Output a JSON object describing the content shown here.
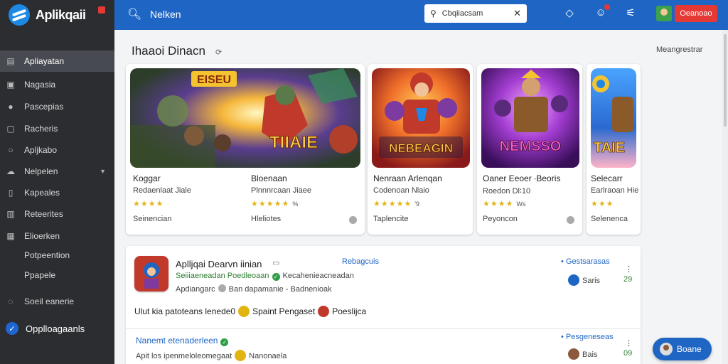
{
  "app": {
    "name": "Aplikqaii",
    "topbar_title": "Nelken"
  },
  "search": {
    "value": "Cbqiiacsam"
  },
  "topbar": {
    "button_label": "Oeanoao"
  },
  "sidebar": {
    "items": [
      {
        "label": "Apliayatan",
        "icon": "file-icon",
        "active": true
      },
      {
        "label": "Nagasia",
        "icon": "image-icon"
      },
      {
        "label": "Pascepias",
        "icon": "user-icon"
      },
      {
        "label": "Racheris",
        "icon": "box-icon"
      },
      {
        "label": "Apljkabo",
        "icon": "circle-icon"
      },
      {
        "label": "Nelpelen",
        "icon": "cloud-icon"
      },
      {
        "label": "Kapeales",
        "icon": "doc-icon"
      },
      {
        "label": "Reteerites",
        "icon": "device-icon"
      },
      {
        "label": "Elioerken",
        "icon": "grid-icon"
      },
      {
        "label": "Potpeention"
      },
      {
        "label": "Ppapele"
      },
      {
        "label": "Soeil eanerie",
        "icon": "help-icon"
      },
      {
        "label": "Opplloagaanls",
        "icon": "check-badge-icon"
      }
    ]
  },
  "section": {
    "title": "Ihaaoi Dinacn",
    "see_more": "Meangrestrar"
  },
  "cards": [
    {
      "title": "Koggar",
      "subtitle": "Redaenlaat Jiale",
      "stars": "★★★★",
      "count": "",
      "footer": "Seinencian",
      "image_text": "EISEU",
      "image_text2": "TIIAIE"
    },
    {
      "title": "Bloenaan",
      "subtitle": "Plnnnrcaan Jiaee",
      "stars": "★★★★★",
      "count": "%",
      "footer": "Hleliotes"
    },
    {
      "title": "Nenraan Arlenqan",
      "subtitle": "Codenoan Nlaio",
      "stars": "★★★★★",
      "count": "'9",
      "footer": "Taplencite",
      "image_text": "NEBEAGIN"
    },
    {
      "title": "Oaner Eeoer ∙Beoris",
      "subtitle": "Roedon Dl∶10",
      "stars": "★★★★",
      "count": "Ws",
      "footer": "Peyoncon",
      "image_text": "NEMSSO"
    },
    {
      "title": "Selecarr",
      "subtitle": "Earlraoan Hie",
      "stars": "★★★",
      "count": "",
      "footer": "Selenenca",
      "image_text": "TAIE"
    }
  ],
  "list": {
    "row1": {
      "title": "Aplljqai Dearvn iinian",
      "link": "Rebagcuis",
      "green": "Seiiiaeneadan Poedleoaan",
      "green2": "Kecahenieacneadan",
      "gray": "Apdiangarc",
      "gray2": "Ban dapamanie - Badnenioak",
      "right_link": "Gestsarasas",
      "user": "Saris",
      "num": "29",
      "more": "⋮"
    },
    "row1b": {
      "a": "Ulut kia patoteans lenede0",
      "b": "Spaint Pengaset",
      "c": "Poeslijca"
    },
    "row2": {
      "title": "Nanemt etenaderleen",
      "gray": "Apit los ipenmeloleomegaat",
      "gray2": "Nanonaela",
      "right_link": "Pesgeneseas",
      "user": "Bais",
      "num": "09",
      "more": "⋮"
    }
  },
  "chat": {
    "label": "Boane"
  },
  "colors": {
    "topbar": "#1f66c4",
    "sidebar": "#2b2d31",
    "accent_red": "#e53935",
    "star": "#e2b413"
  }
}
